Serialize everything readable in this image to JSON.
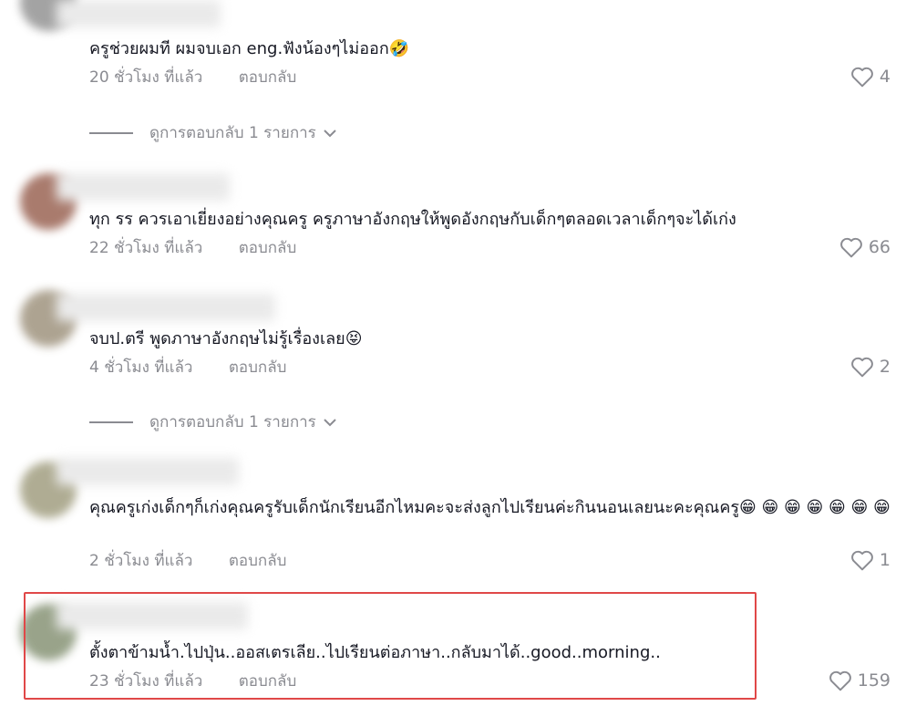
{
  "comments": [
    {
      "text": "ครูช่วยผมที ผมจบเอก eng.ฟังน้องๆไม่ออก🤣",
      "time": "20 ชั่วโมง ที่แล้ว",
      "reply_label": "ตอบกลับ",
      "likes": "4",
      "view_replies": "ดูการตอบกลับ 1 รายการ"
    },
    {
      "text": "ทุก รร ควรเอาเยี่ยงอย่างคุณครู ครูภาษาอังกฤษให้พูดอังกฤษกับเด็กๆตลอดเวลาเด็กๆจะได้เก่ง",
      "time": "22 ชั่วโมง ที่แล้ว",
      "reply_label": "ตอบกลับ",
      "likes": "66"
    },
    {
      "text": "จบป.ตรี พูดภาษาอังกฤษไม่รู้เรื่องเลย😝",
      "time": "4 ชั่วโมง ที่แล้ว",
      "reply_label": "ตอบกลับ",
      "likes": "2",
      "view_replies": "ดูการตอบกลับ 1 รายการ"
    },
    {
      "text": "คุณครูเก่งเด็กๆก็เก่งคุณครูรับเด็กนักเรียนอีกไหมคะจะส่งลูกไปเรียนค่ะกินนอนเลยนะคะคุณครู😁 😁 😁 😁 😁 😁 😁",
      "time": "2 ชั่วโมง ที่แล้ว",
      "reply_label": "ตอบกลับ",
      "likes": "1"
    },
    {
      "text": "ตั้งตาข้ามน้ำ.ไปปุ่น..ออสเตรเลีย..ไปเรียนต่อภาษา..กลับมาได้..good..morning..",
      "time": "23 ชั่วโมง ที่แล้ว",
      "reply_label": "ตอบกลับ",
      "likes": "159"
    }
  ],
  "colors": {
    "text": "#161823",
    "muted": "#8a8b91",
    "highlight": "#e04848"
  },
  "icons": {
    "like": "heart-outline-icon",
    "expand": "chevron-down-icon"
  }
}
